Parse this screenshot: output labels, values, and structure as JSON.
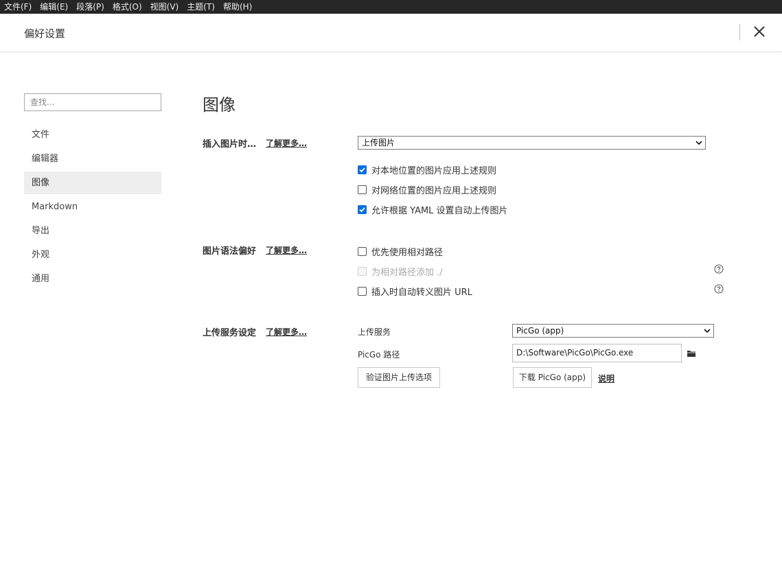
{
  "menubar": {
    "items": [
      "文件(F)",
      "编辑(E)",
      "段落(P)",
      "格式(O)",
      "视图(V)",
      "主题(T)",
      "帮助(H)"
    ]
  },
  "header": {
    "title": "偏好设置",
    "close_icon": "close-icon"
  },
  "sidebar": {
    "search_placeholder": "查找...",
    "items": [
      {
        "label": "文件",
        "active": false
      },
      {
        "label": "编辑器",
        "active": false
      },
      {
        "label": "图像",
        "active": true
      },
      {
        "label": "Markdown",
        "active": false
      },
      {
        "label": "导出",
        "active": false
      },
      {
        "label": "外观",
        "active": false
      },
      {
        "label": "通用",
        "active": false
      }
    ]
  },
  "main": {
    "title": "图像",
    "insert_section": {
      "label": "插入图片时…",
      "learn_more": "了解更多…",
      "action_select": "上传图片",
      "options": [
        {
          "label": "对本地位置的图片应用上述规则",
          "checked": true
        },
        {
          "label": "对网络位置的图片应用上述规则",
          "checked": false
        },
        {
          "label": "允许根据 YAML 设置自动上传图片",
          "checked": true
        }
      ]
    },
    "syntax_section": {
      "label": "图片语法偏好",
      "learn_more": "了解更多…",
      "options": [
        {
          "label": "优先使用相对路径",
          "checked": false,
          "disabled": false
        },
        {
          "label": "为相对路径添加 ./",
          "checked": false,
          "disabled": true
        },
        {
          "label": "插入时自动转义图片 URL",
          "checked": false,
          "disabled": false
        }
      ]
    },
    "upload_section": {
      "label": "上传服务设定",
      "learn_more": "了解更多…",
      "service_label": "上传服务",
      "service_value": "PicGo (app)",
      "path_label": "PicGo 路径",
      "path_value": "D:\\Software\\PicGo\\PicGo.exe",
      "verify_button": "验证图片上传选项",
      "download_button": "下载 PicGo (app)",
      "explain_link": "说明"
    }
  },
  "colors": {
    "menubar_bg": "#262626",
    "checkbox_accent": "#0a6fdb",
    "active_nav_bg": "#eeeeee"
  }
}
